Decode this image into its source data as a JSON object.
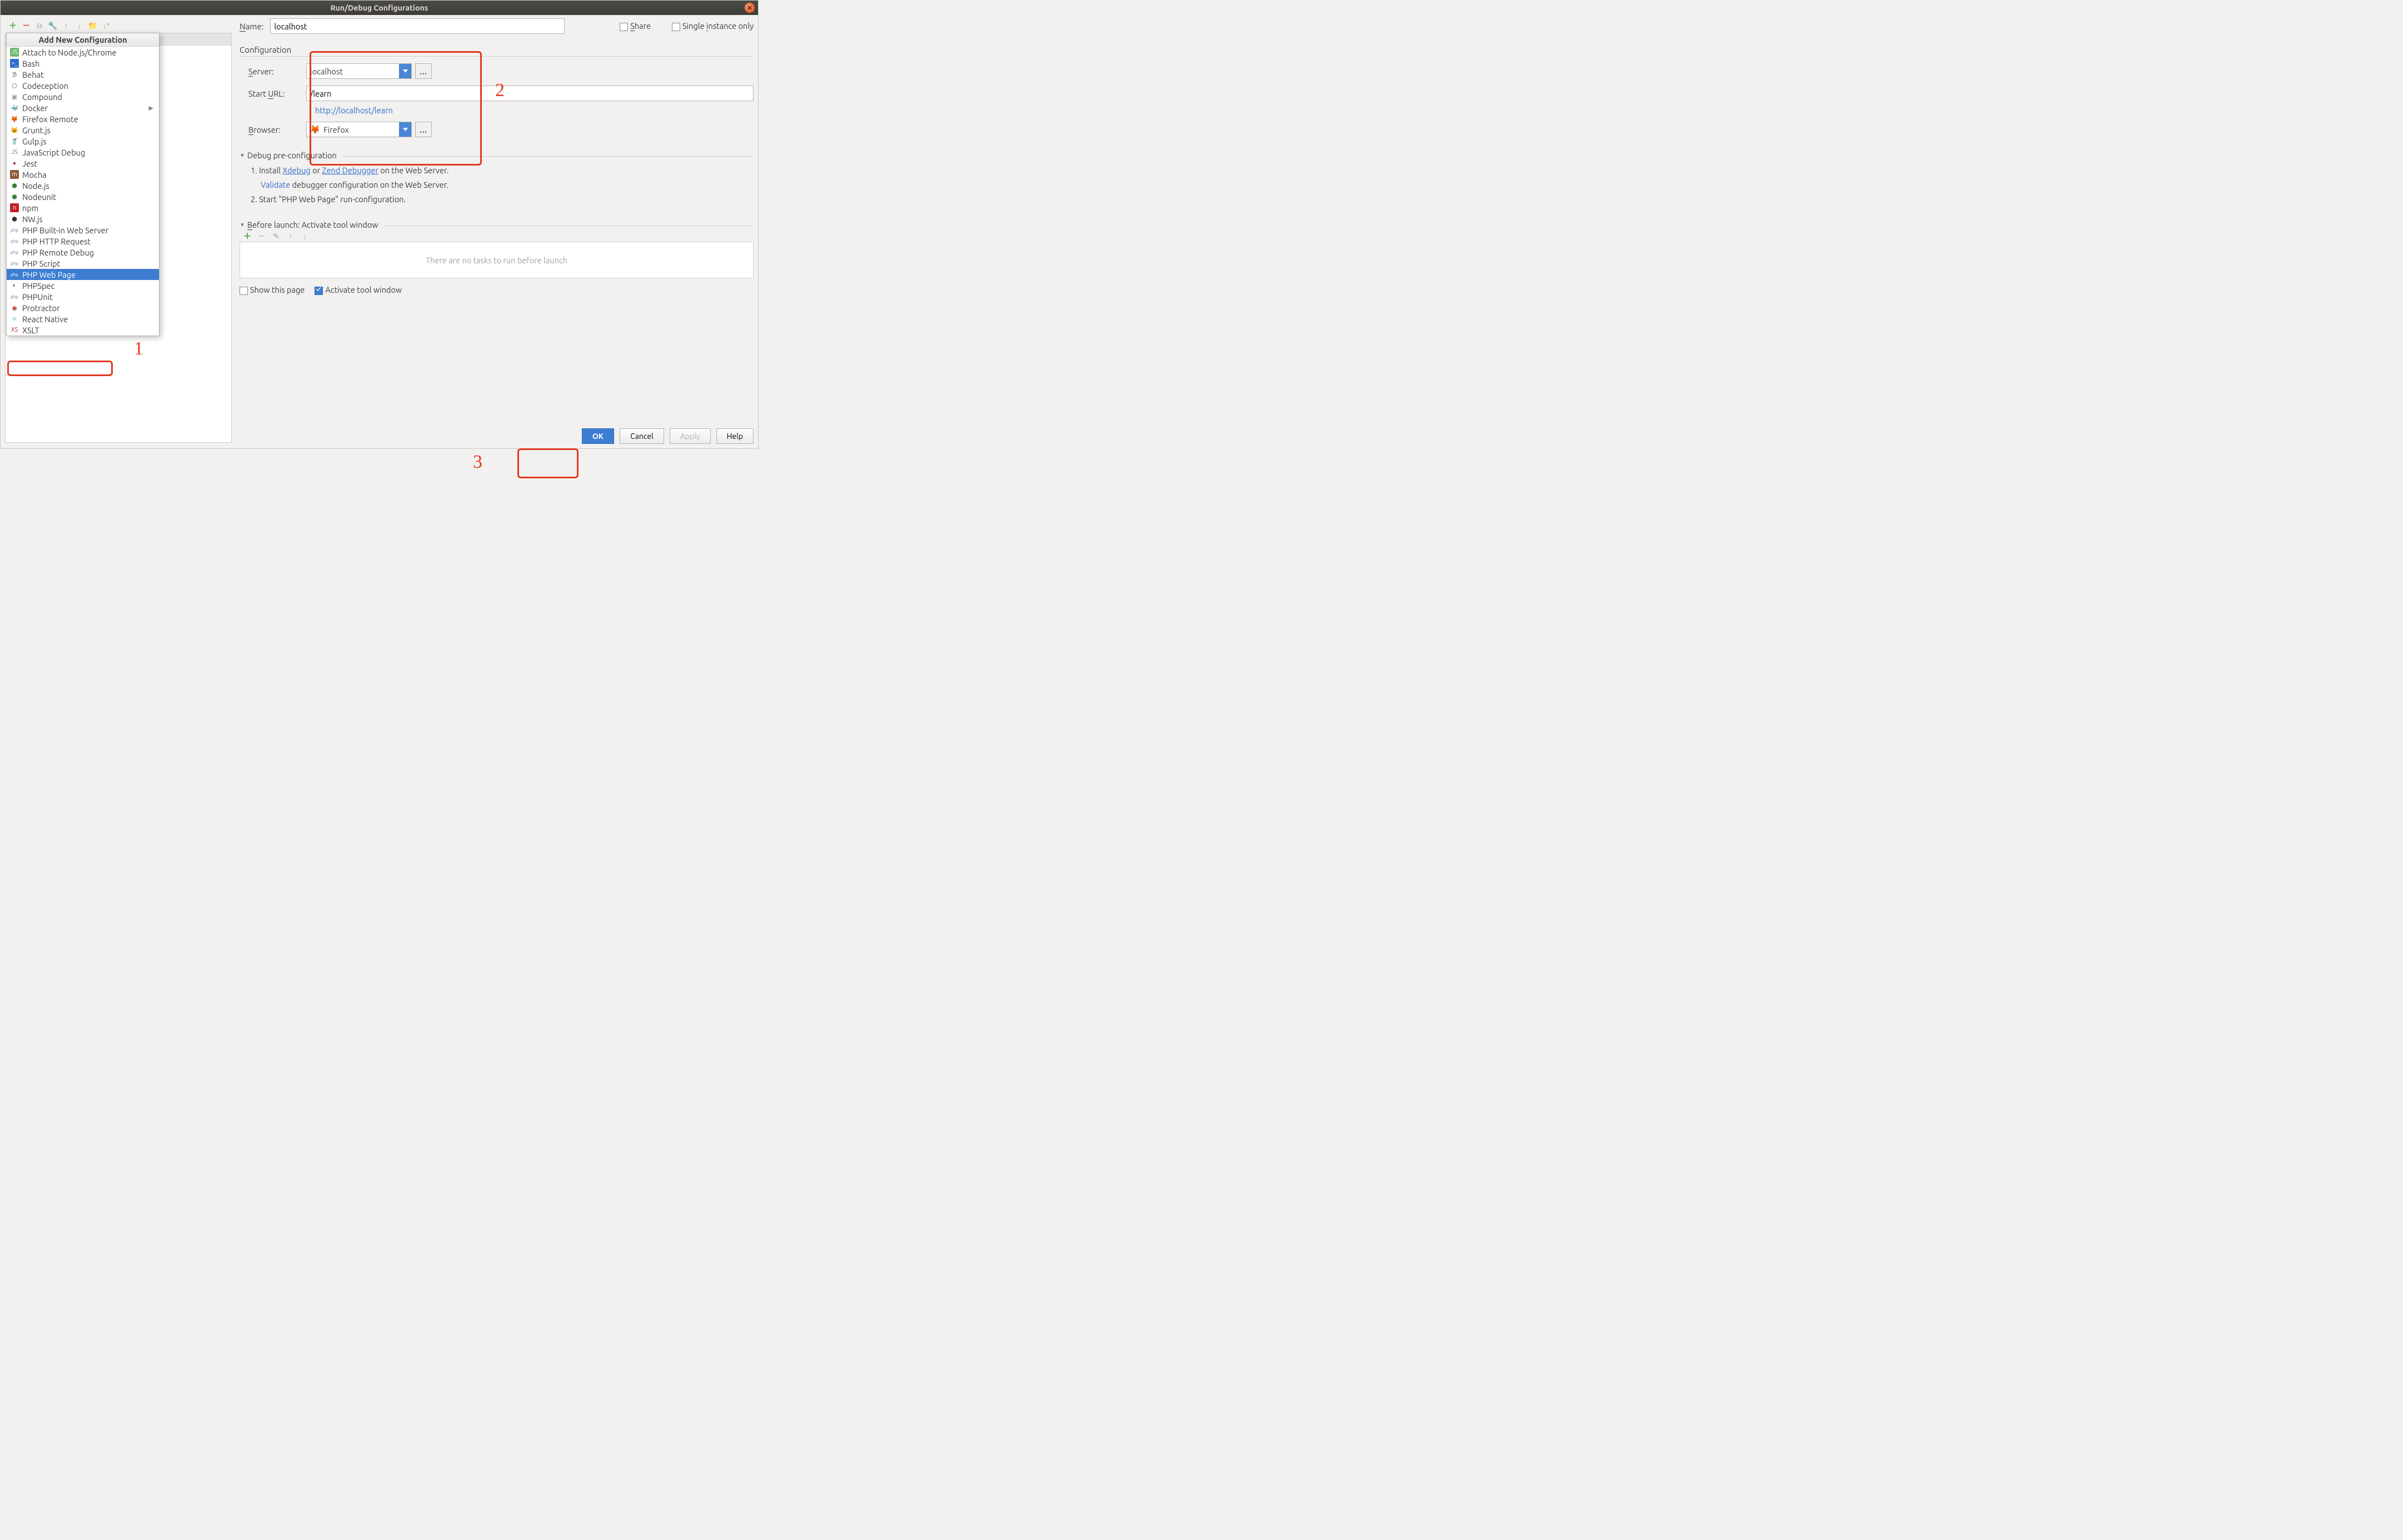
{
  "title": "Run/Debug Configurations",
  "leftHeader": "Add New Configuration",
  "configs": [
    {
      "label": "Attach to Node.js/Chrome",
      "iconBg": "#6fb86f",
      "iconFg": "#fff",
      "iconTxt": "JS"
    },
    {
      "label": "Bash",
      "iconBg": "#2e6bcc",
      "iconFg": "#fff",
      "iconTxt": ">_"
    },
    {
      "label": "Behat",
      "iconBg": "transparent",
      "iconFg": "#333",
      "iconTxt": "ℬ"
    },
    {
      "label": "Codeception",
      "iconBg": "transparent",
      "iconFg": "#5a6b2a",
      "iconTxt": "⬡"
    },
    {
      "label": "Compound",
      "iconBg": "transparent",
      "iconFg": "#9c998f",
      "iconTxt": "▣"
    },
    {
      "label": "Docker",
      "iconBg": "transparent",
      "iconFg": "#2497d7",
      "iconTxt": "🐳",
      "hasSub": true
    },
    {
      "label": "Firefox Remote",
      "iconBg": "transparent",
      "iconFg": "#e06b1f",
      "iconTxt": "🦊"
    },
    {
      "label": "Grunt.js",
      "iconBg": "transparent",
      "iconFg": "#b88b2a",
      "iconTxt": "😺"
    },
    {
      "label": "Gulp.js",
      "iconBg": "transparent",
      "iconFg": "#d14a3f",
      "iconTxt": "🥤"
    },
    {
      "label": "JavaScript Debug",
      "iconBg": "transparent",
      "iconFg": "#5b8f3e",
      "iconTxt": "JS"
    },
    {
      "label": "Jest",
      "iconBg": "transparent",
      "iconFg": "#99244f",
      "iconTxt": "✦"
    },
    {
      "label": "Mocha",
      "iconBg": "#8d5a3b",
      "iconFg": "#fff",
      "iconTxt": "m"
    },
    {
      "label": "Node.js",
      "iconBg": "transparent",
      "iconFg": "#3b7d3b",
      "iconTxt": "⬢"
    },
    {
      "label": "Nodeunit",
      "iconBg": "transparent",
      "iconFg": "#3b7d3b",
      "iconTxt": "⬢"
    },
    {
      "label": "npm",
      "iconBg": "#c12127",
      "iconFg": "#fff",
      "iconTxt": "n"
    },
    {
      "label": "NW.js",
      "iconBg": "transparent",
      "iconFg": "#333",
      "iconTxt": "⬢"
    },
    {
      "label": "PHP Built-in Web Server",
      "iconBg": "transparent",
      "iconFg": "#6a7da0",
      "iconTxt": "php"
    },
    {
      "label": "PHP HTTP Request",
      "iconBg": "transparent",
      "iconFg": "#6a7da0",
      "iconTxt": "php"
    },
    {
      "label": "PHP Remote Debug",
      "iconBg": "transparent",
      "iconFg": "#6a7da0",
      "iconTxt": "php"
    },
    {
      "label": "PHP Script",
      "iconBg": "transparent",
      "iconFg": "#6a7da0",
      "iconTxt": "php"
    },
    {
      "label": "PHP Web Page",
      "iconBg": "transparent",
      "iconFg": "#fff",
      "iconTxt": "php",
      "selected": true
    },
    {
      "label": "PHPSpec",
      "iconBg": "transparent",
      "iconFg": "#5a6b2a",
      "iconTxt": "◐"
    },
    {
      "label": "PHPUnit",
      "iconBg": "transparent",
      "iconFg": "#6a7da0",
      "iconTxt": "php"
    },
    {
      "label": "Protractor",
      "iconBg": "transparent",
      "iconFg": "#b33a3a",
      "iconTxt": "◉"
    },
    {
      "label": "React Native",
      "iconBg": "transparent",
      "iconFg": "#3aa6c9",
      "iconTxt": "⚛"
    },
    {
      "label": "XSLT",
      "iconBg": "transparent",
      "iconFg": "#c12127",
      "iconTxt": "XS"
    }
  ],
  "nameLabel": "Name:",
  "nameValue": "localhost",
  "shareLabel": "Share",
  "singleLabel": "Single instance only",
  "configSection": "Configuration",
  "serverLabel": "Server:",
  "serverValue": "localhost",
  "startUrlLabel": "Start URL:",
  "startUrlValue": "/learn",
  "resolvedUrl": "http://localhost/learn",
  "browserLabel": "Browser:",
  "browserValue": "Firefox",
  "debugPre": "Debug pre-configuration",
  "step1a": "Install ",
  "xdebug": "Xdebug",
  "or": " or ",
  "zend": "Zend Debugger",
  "step1b": " on the Web Server.",
  "validate": "Validate",
  "step1c": " debugger configuration on the Web Server.",
  "step2": "Start \"PHP Web Page\" run-configuration.",
  "beforeLaunch": "Before launch: Activate tool window",
  "noTasks": "There are no tasks to run before launch",
  "showPage": "Show this page",
  "activateTool": "Activate tool window",
  "ok": "OK",
  "cancel": "Cancel",
  "apply": "Apply",
  "help": "Help",
  "annot1": "1",
  "annot2": "2",
  "annot3": "3"
}
